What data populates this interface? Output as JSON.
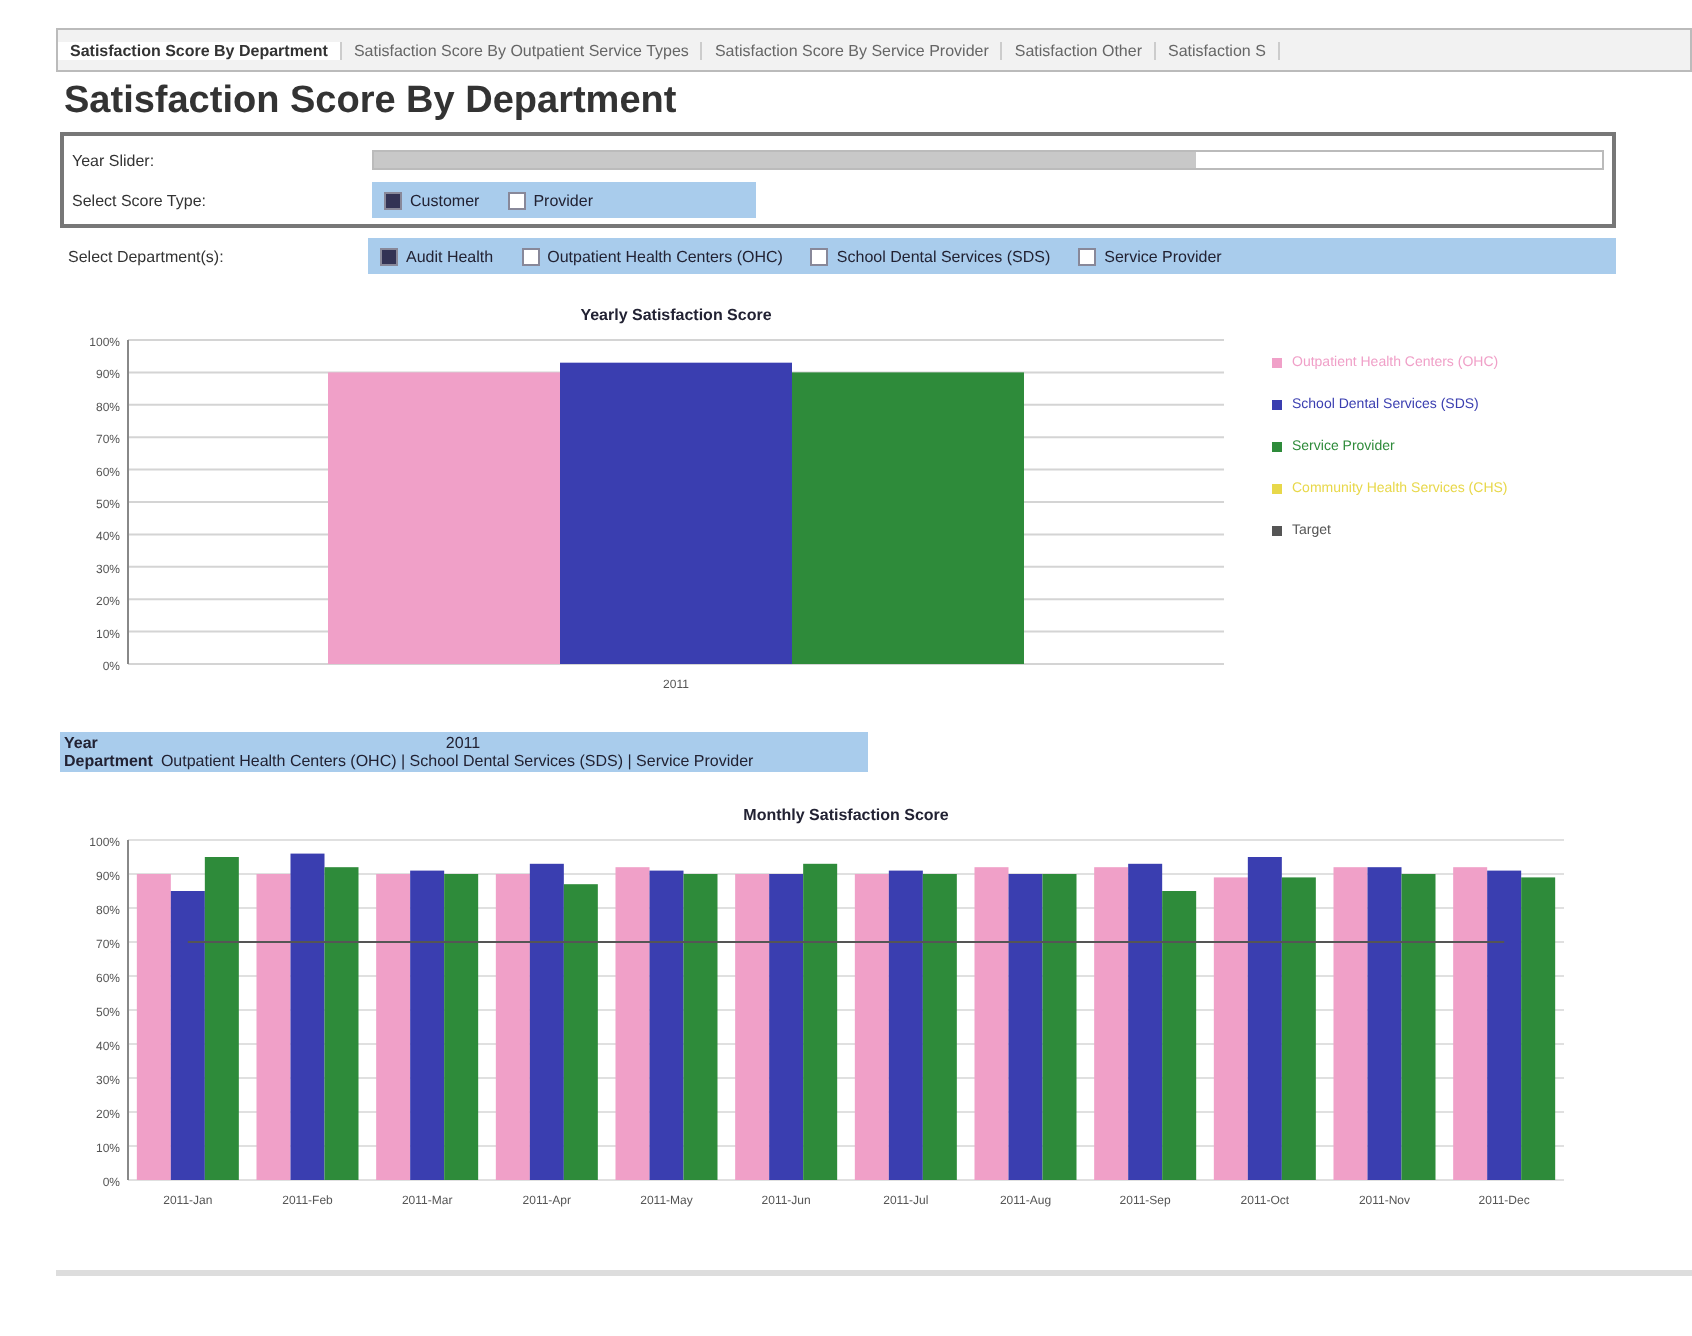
{
  "tabs": [
    {
      "label": "Satisfaction Score By Department",
      "selected": true
    },
    {
      "label": "Satisfaction Score By Outpatient Service Types",
      "selected": false
    },
    {
      "label": "Satisfaction Score By Service Provider",
      "selected": false
    },
    {
      "label": "Satisfaction Other",
      "selected": false
    },
    {
      "label": "Satisfaction S",
      "selected": false
    }
  ],
  "title": "Satisfaction Score By Department",
  "filters": {
    "year_slider": {
      "label": "Year Slider:",
      "level": 0.67
    },
    "score_type": {
      "label": "Select Score Type:",
      "options": [
        {
          "label": "Customer",
          "checked": true
        },
        {
          "label": "Provider",
          "checked": false
        }
      ]
    },
    "department": {
      "label": "Select Department(s):",
      "options": [
        {
          "label": "Audit Health",
          "checked": true
        },
        {
          "label": "Outpatient Health Centers (OHC)",
          "checked": false
        },
        {
          "label": "School Dental Services (SDS)",
          "checked": false
        },
        {
          "label": "Service Provider",
          "checked": false
        }
      ]
    }
  },
  "yearly_chart": {
    "chart_data": {
      "type": "bar",
      "title": "Yearly Satisfaction Score",
      "categories": [
        "2011"
      ],
      "ylim": [
        0,
        100
      ],
      "grid": true,
      "legend": "right",
      "yticks": [
        {
          "value": 0,
          "label": "0%"
        },
        {
          "value": 10,
          "label": "10%"
        },
        {
          "value": 20,
          "label": "20%"
        },
        {
          "value": 30,
          "label": "30%"
        },
        {
          "value": 40,
          "label": "40%"
        },
        {
          "value": 50,
          "label": "50%"
        },
        {
          "value": 60,
          "label": "60%"
        },
        {
          "value": 70,
          "label": "70%"
        },
        {
          "value": 80,
          "label": "80%"
        },
        {
          "value": 90,
          "label": "90%"
        },
        {
          "value": 100,
          "label": "100%"
        }
      ],
      "series": [
        {
          "name": "Outpatient Health Centers (OHC)",
          "color": "#f0a0c8",
          "values": [
            90
          ]
        },
        {
          "name": "School Dental Services (SDS)",
          "color": "#3a3eb0",
          "values": [
            93
          ]
        },
        {
          "name": "Service Provider",
          "color": "#2e8b3a",
          "values": [
            90
          ]
        },
        {
          "name": "Community Health Services (CHS)",
          "color": "#e8d84a",
          "values": [
            null
          ]
        },
        {
          "name": "Target",
          "color": "#555555",
          "values": [
            null
          ]
        }
      ]
    }
  },
  "summary": {
    "year_label": "Year",
    "year": "2011",
    "department_label": "Department",
    "departments": "Outpatient Health Centers (OHC) | School Dental Services (SDS) | Service Provider"
  },
  "monthly_chart": {
    "chart_data": {
      "type": "bar",
      "title": "Monthly Satisfaction Score",
      "categories": [
        "2011-Jan",
        "2011-Feb",
        "2011-Mar",
        "2011-Apr",
        "2011-May",
        "2011-Jun",
        "2011-Jul",
        "2011-Aug",
        "2011-Sep",
        "2011-Oct",
        "2011-Nov",
        "2011-Dec"
      ],
      "ylim": [
        0,
        100
      ],
      "grid": true,
      "yticks": [
        {
          "value": 0,
          "label": "0%"
        },
        {
          "value": 10,
          "label": "10%"
        },
        {
          "value": 20,
          "label": "20%"
        },
        {
          "value": 30,
          "label": "30%"
        },
        {
          "value": 40,
          "label": "40%"
        },
        {
          "value": 50,
          "label": "50%"
        },
        {
          "value": 60,
          "label": "60%"
        },
        {
          "value": 70,
          "label": "70%"
        },
        {
          "value": 80,
          "label": "80%"
        },
        {
          "value": 90,
          "label": "90%"
        },
        {
          "value": 100,
          "label": "100%"
        }
      ],
      "series": [
        {
          "color": "#f0a0c8",
          "values": [
            90,
            90,
            90,
            90,
            92,
            90,
            90,
            92,
            92,
            89,
            92,
            92
          ]
        },
        {
          "color": "#3a3eb0",
          "values": [
            85,
            96,
            91,
            93,
            91,
            90,
            91,
            90,
            93,
            95,
            92,
            91
          ]
        },
        {
          "color": "#2e8b3a",
          "values": [
            95,
            92,
            90,
            87,
            90,
            93,
            90,
            90,
            85,
            89,
            90,
            89
          ]
        },
        {
          "type": "line",
          "color": "#555555",
          "values": [
            70,
            70,
            70,
            70,
            70,
            70,
            70,
            70,
            70,
            70,
            70,
            70
          ]
        }
      ]
    }
  }
}
